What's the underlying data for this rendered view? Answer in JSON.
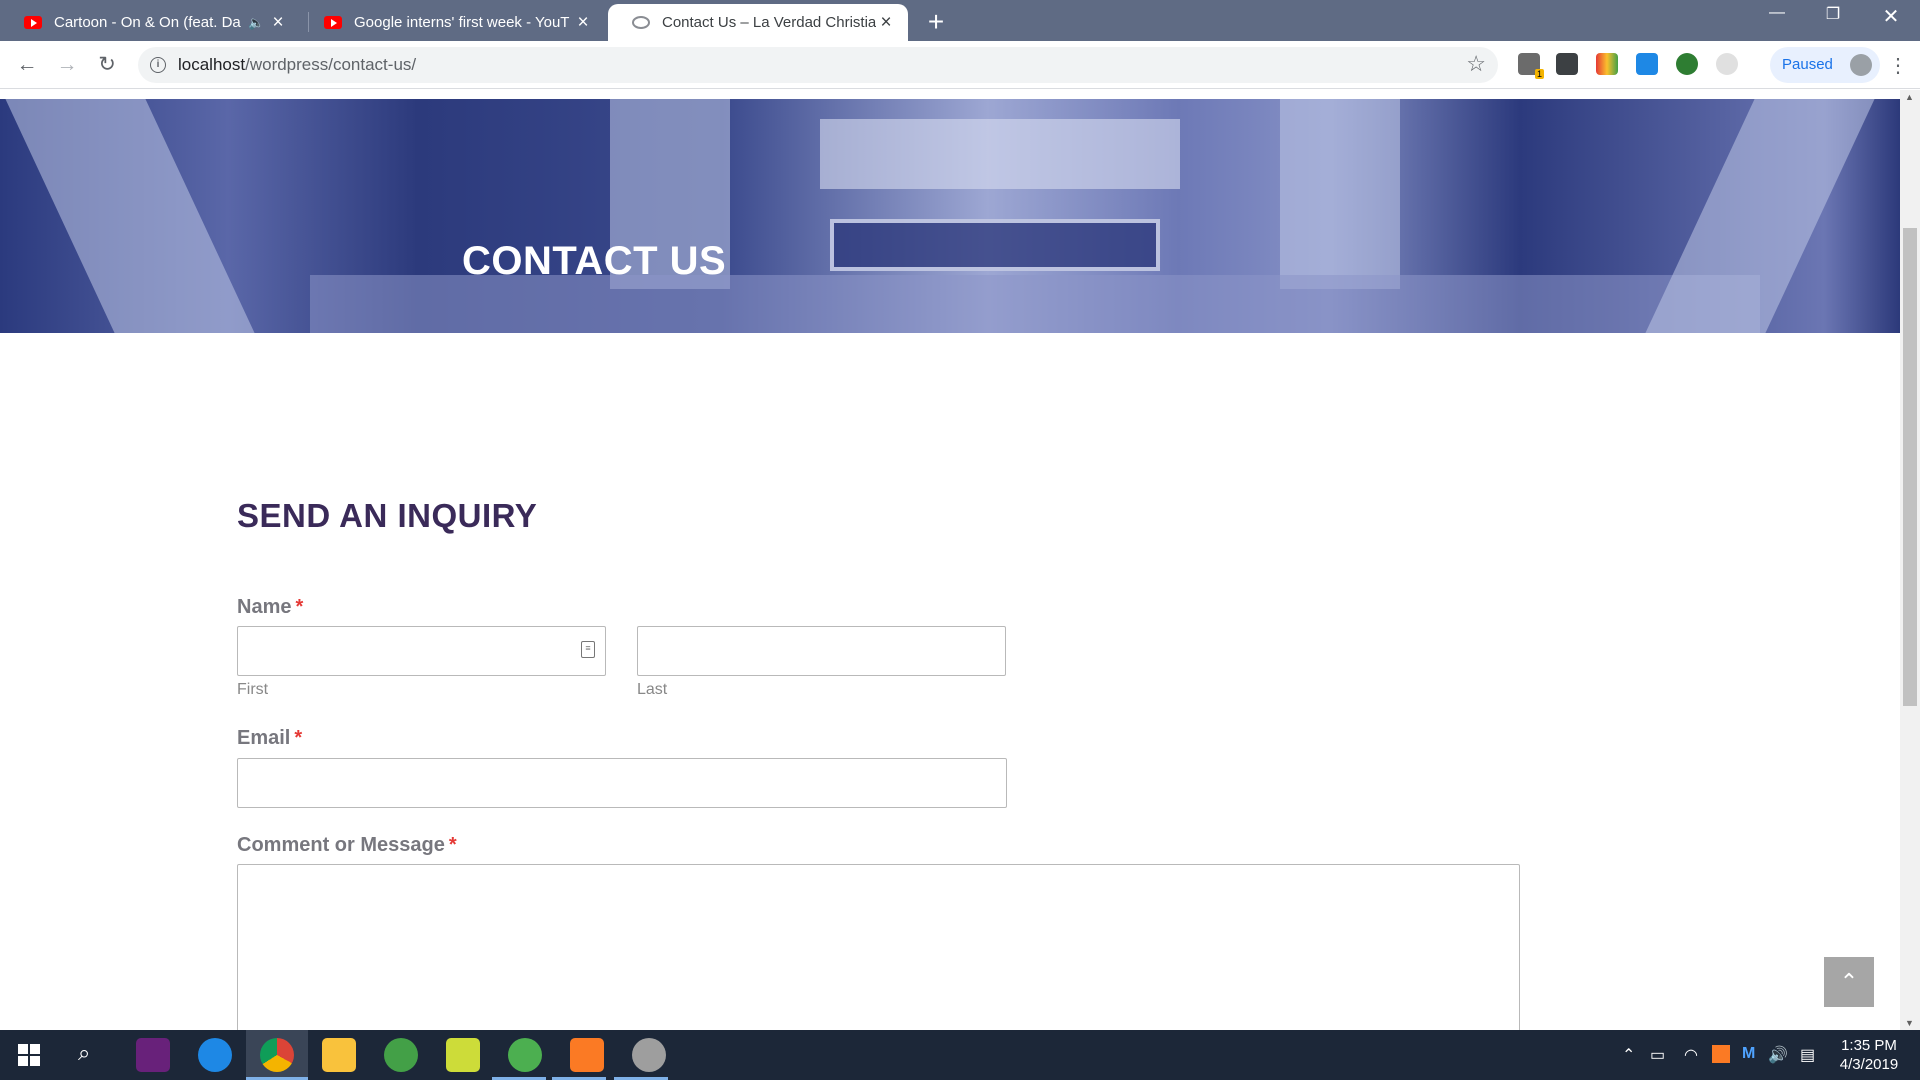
{
  "browser": {
    "tabs": [
      {
        "title": "Cartoon - On & On (feat. Da",
        "favicon": "youtube-icon",
        "audio": "speaker-icon"
      },
      {
        "title": "Google interns' first week - YouT",
        "favicon": "youtube-icon"
      },
      {
        "title": "Contact Us – La Verdad Christian",
        "favicon": "globe-icon",
        "active": true
      }
    ],
    "address": {
      "host": "localhost",
      "path": "/wordpress/contact-us/"
    },
    "profile_label": "Paused",
    "extension_badge": "1"
  },
  "page": {
    "hero_title": "CONTACT US",
    "form_title": "SEND AN INQUIRY",
    "fields": {
      "name_label": "Name",
      "first_sublabel": "First",
      "last_sublabel": "Last",
      "email_label": "Email",
      "message_label": "Comment or Message",
      "required_mark": "*"
    },
    "colors": {
      "heading": "#3a2a59",
      "required": "#e53935",
      "hero_tint": "#2c3a7c"
    }
  },
  "taskbar": {
    "time": "1:35 PM",
    "date": "4/3/2019"
  }
}
